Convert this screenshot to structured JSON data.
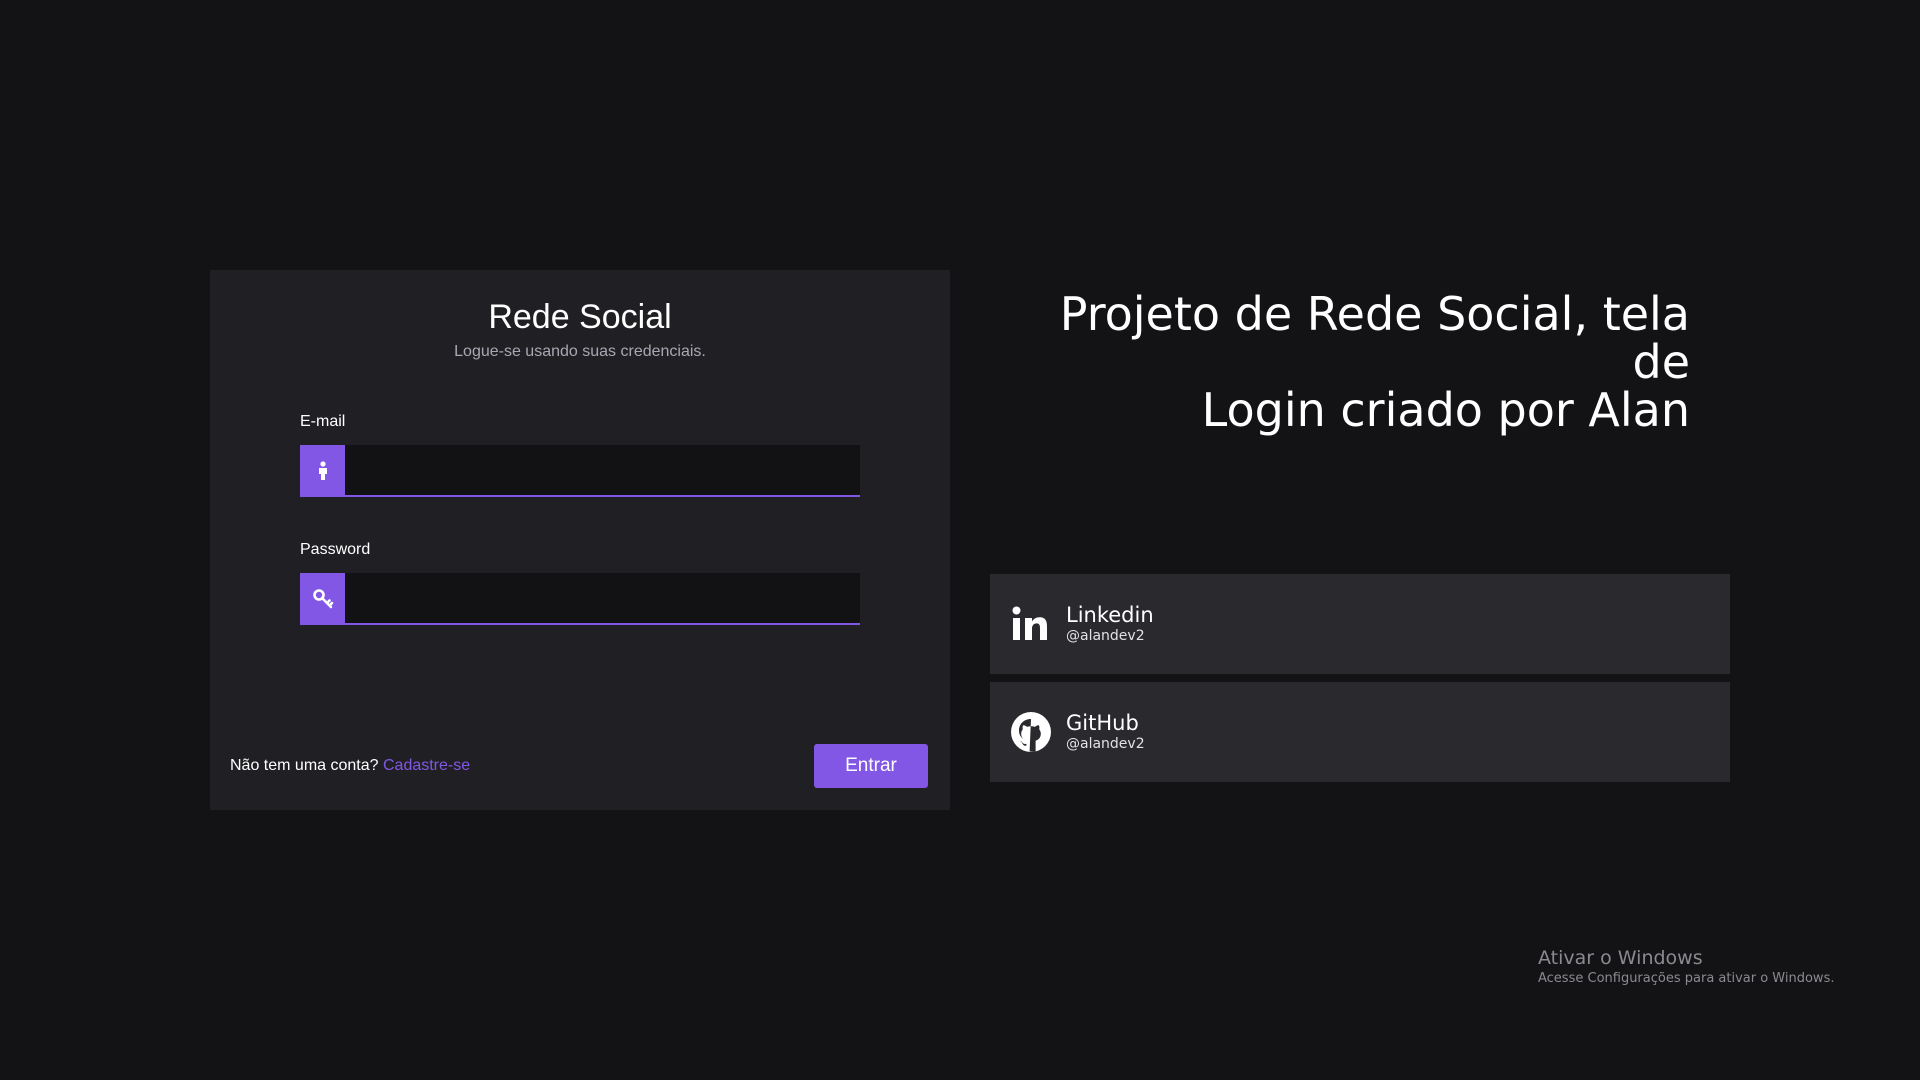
{
  "login": {
    "title": "Rede Social",
    "subtitle": "Logue-se usando suas credenciais.",
    "email_label": "E-mail",
    "email_value": "",
    "email_placeholder": "",
    "password_label": "Password",
    "password_value": "",
    "password_placeholder": "",
    "signup_prompt": "Não tem uma conta?",
    "signup_link": "Cadastre-se",
    "submit_label": "Entrar"
  },
  "hero": {
    "line1": "Projeto de Rede Social, tela de",
    "line2": "Login criado por Alan"
  },
  "social": [
    {
      "name": "Linkedin",
      "handle": "@alandev2",
      "icon": "linkedin-icon"
    },
    {
      "name": "GitHub",
      "handle": "@alandev2",
      "icon": "github-icon"
    }
  ],
  "watermark": {
    "title": "Ativar o Windows",
    "subtitle": "Acesse Configurações para ativar o Windows."
  },
  "colors": {
    "background": "#131316",
    "card": "#202024",
    "social_card": "#29292e",
    "accent": "#8257e5",
    "input_bg": "#121214"
  }
}
